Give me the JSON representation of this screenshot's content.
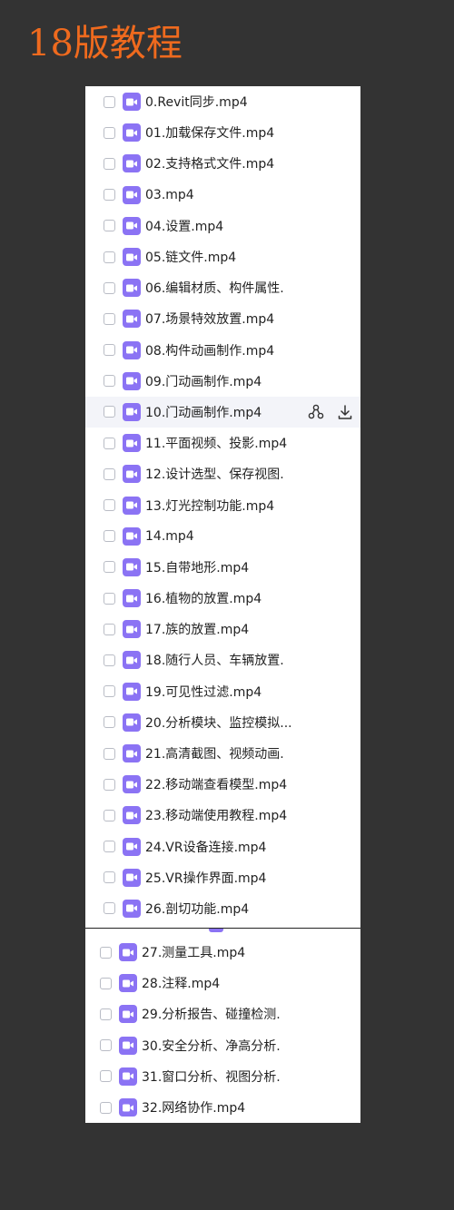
{
  "title": "18版教程",
  "colors": {
    "accent": "#ef6a1e",
    "video_icon": "#8b73f4",
    "background": "#333333"
  },
  "panel1": {
    "files": [
      "0.Revit同步.mp4",
      "01.加载保存文件.mp4",
      "02.支持格式文件.mp4",
      "03.mp4",
      "04.设置.mp4",
      "05.链文件.mp4",
      "06.编辑材质、构件属性.",
      "07.场景特效放置.mp4",
      "08.构件动画制作.mp4",
      "09.门动画制作.mp4",
      "10.门动画制作.mp4",
      "11.平面视频、投影.mp4",
      "12.设计选型、保存视图.",
      "13.灯光控制功能.mp4",
      "14.mp4",
      "15.自带地形.mp4",
      "16.植物的放置.mp4",
      "17.族的放置.mp4",
      "18.随行人员、车辆放置.",
      "19.可见性过滤.mp4",
      "20.分析模块、监控模拟...",
      "21.高清截图、视频动画.",
      "22.移动端查看模型.mp4",
      "23.移动端使用教程.mp4",
      "24.VR设备连接.mp4",
      "25.VR操作界面.mp4",
      "26.剖切功能.mp4"
    ],
    "hover_index": 10,
    "action_icons": [
      "share-icon",
      "download-icon"
    ]
  },
  "panel2": {
    "files": [
      "27.测量工具.mp4",
      "28.注释.mp4",
      "29.分析报告、碰撞检测.",
      "30.安全分析、净高分析.",
      "31.窗口分析、视图分析.",
      "32.网络协作.mp4"
    ]
  }
}
